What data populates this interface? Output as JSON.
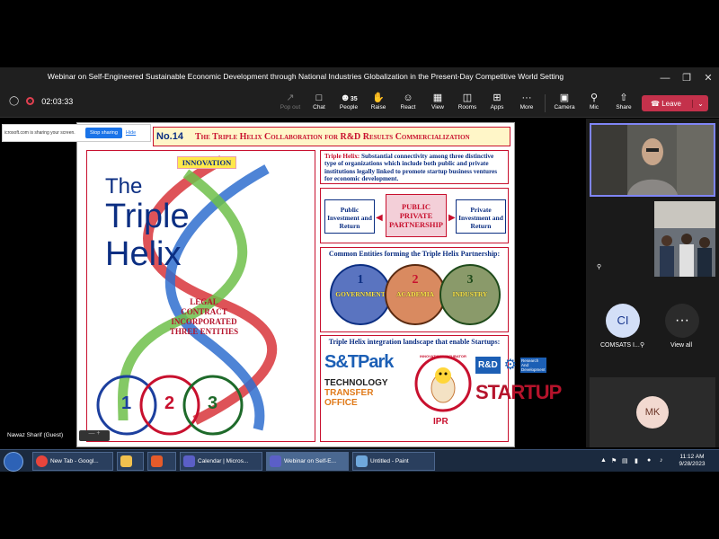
{
  "window": {
    "title": "Webinar on Self-Engineered Sustainable Economic Development through National Industries Globalization in the Present-Day Competitive World Setting",
    "minimize_icon": "minimize-icon",
    "restore_icon": "restore-icon",
    "close_icon": "close-icon"
  },
  "toolbar": {
    "timer": "02:03:33",
    "buttons": [
      {
        "label": "Pop out",
        "icon": "pop-out-icon",
        "enabled": false
      },
      {
        "label": "Chat",
        "icon": "chat-icon",
        "enabled": true
      },
      {
        "label": "People",
        "icon": "people-icon",
        "count": "35",
        "enabled": true
      },
      {
        "label": "Raise",
        "icon": "raise-hand-icon",
        "enabled": true
      },
      {
        "label": "React",
        "icon": "react-icon",
        "enabled": true
      },
      {
        "label": "View",
        "icon": "view-icon",
        "enabled": true
      },
      {
        "label": "Rooms",
        "icon": "rooms-icon",
        "enabled": true
      },
      {
        "label": "Apps",
        "icon": "apps-icon",
        "enabled": true
      },
      {
        "label": "More",
        "icon": "more-icon",
        "enabled": true
      },
      {
        "label": "Camera",
        "icon": "camera-off-icon",
        "enabled": true
      },
      {
        "label": "Mic",
        "icon": "mic-off-icon",
        "enabled": true
      },
      {
        "label": "Share",
        "icon": "share-icon",
        "enabled": true
      }
    ],
    "leave_label": "Leave",
    "leave_color": "#c4314b"
  },
  "share_bar": {
    "text": "icrosoft.com is sharing your screen.",
    "stop_label": "Stop sharing",
    "hide_label": "Hide"
  },
  "slide": {
    "number": "No.14",
    "title": "The Triple Helix Collaboration for R&D Results Commercialization",
    "innovation_tag": "INNOVATION",
    "big_title_1": "The",
    "big_title_2": "Triple",
    "big_title_3": "Helix",
    "legal_1": "LEGAL CONTRACT",
    "legal_2": "INCORPORATED",
    "legal_3": "THREE ENTITIES",
    "circle_nums": [
      "1",
      "2",
      "3"
    ],
    "definition_lead": "Triple Helix:",
    "definition_text": " Substantial connectivity among three distinctive type of organizations which include both public and private institutions legally linked to promote startup business ventures for economic development.",
    "ppp_left": "Public Investment and Return",
    "ppp_mid": "PUBLIC PRIVATE PARTNERSHIP",
    "ppp_right": "Private Investment and Return",
    "entities_title": "Common Entities forming the Triple Helix Partnership:",
    "entities": [
      {
        "num": "1",
        "name": "GOVERNMENT"
      },
      {
        "num": "2",
        "name": "ACADEMIA"
      },
      {
        "num": "3",
        "name": "INDUSTRY"
      }
    ],
    "landscape_title": "Triple Helix integration landscape that enable Startups:",
    "stp_brand": "S&TPark",
    "tech_1": "TECHNOLOGY",
    "tech_2": "TRANSFER",
    "tech_3": "OFFICE",
    "incub_ring": "INNOVATION · INCUBATOR",
    "ipr": "IPR",
    "rd": "R&D",
    "rd_small_1": "Research",
    "rd_small_2": "And",
    "rd_small_3": "Development",
    "startup": "STARTUP"
  },
  "participants": {
    "ci_initials": "CI",
    "ci_label": "COMSATS I...",
    "view_all_label": "View all",
    "more_icon": "ellipsis-icon",
    "mk_initials": "MK"
  },
  "guest_label": "Nawaz Sharif (Guest)",
  "taskbar": {
    "items": [
      {
        "label": "New Tab - Googl...",
        "icon": "chrome-icon",
        "color": "#e8453c"
      },
      {
        "label": "",
        "icon": "folder-icon",
        "color": "#f2c14e"
      },
      {
        "label": "",
        "icon": "app-icon",
        "color": "#e55b2a"
      },
      {
        "label": "Calendar | Micros...",
        "icon": "teams-icon",
        "color": "#5b5fc7"
      },
      {
        "label": "Webinar on Self-E...",
        "icon": "teams-icon",
        "color": "#5b5fc7"
      },
      {
        "label": "Untitled - Paint",
        "icon": "paint-icon",
        "color": "#6fa8dc"
      }
    ],
    "time": "11:12 AM",
    "date": "9/28/2023"
  }
}
